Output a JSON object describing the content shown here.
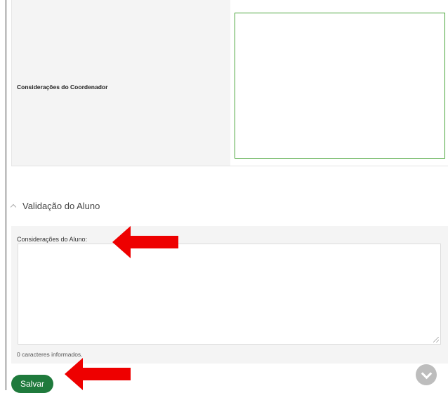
{
  "coordenador": {
    "label": "Considerações do Coordenador",
    "value": ""
  },
  "validacao": {
    "section_title": "Validação do Aluno",
    "label": "Considerações do Aluno:",
    "value": "",
    "char_count": "0 caracteres informados."
  },
  "actions": {
    "save_label": "Salvar"
  },
  "icons": {
    "collapse": "chevron-up-icon",
    "scroll": "chevron-down-icon",
    "annotation": "red-arrow-icon"
  },
  "colors": {
    "accent": "#1f7a3c",
    "focus_border": "#4aa53b",
    "annotation": "#ee0000"
  }
}
